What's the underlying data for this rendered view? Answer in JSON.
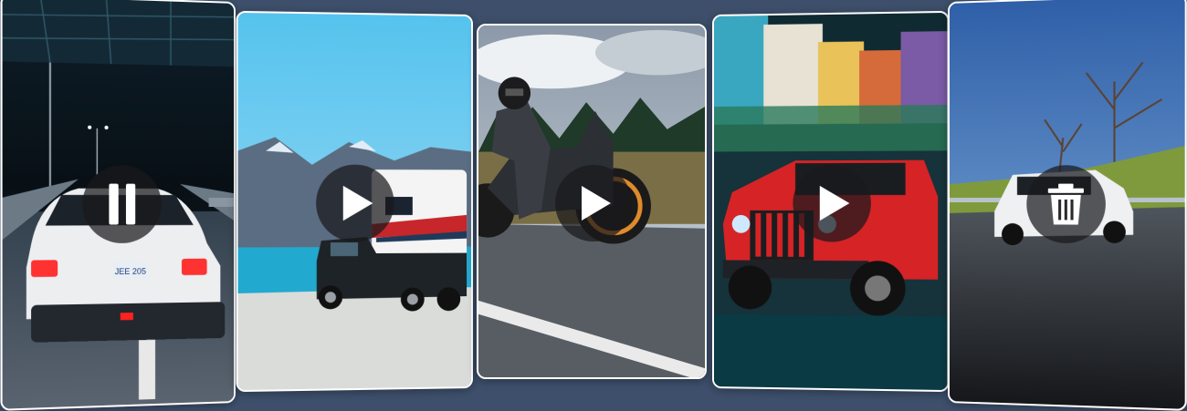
{
  "carousel": {
    "cards": [
      {
        "id": 1,
        "subject": "night-road-white-car",
        "control": "pause-icon",
        "plate": "JEE 205"
      },
      {
        "id": 2,
        "subject": "pickup-camper-lake",
        "control": "play-icon"
      },
      {
        "id": 3,
        "subject": "motorcycle-rider-road",
        "control": "play-icon"
      },
      {
        "id": 4,
        "subject": "red-jeep-city",
        "control": "play-icon"
      },
      {
        "id": 5,
        "subject": "white-car-highway",
        "control": "trash-icon"
      }
    ]
  },
  "colors": {
    "background": "#3d4f6b",
    "card_border": "#ffffff",
    "control_bg": "rgba(25,25,28,0.72)",
    "control_icon": "#ffffff"
  }
}
